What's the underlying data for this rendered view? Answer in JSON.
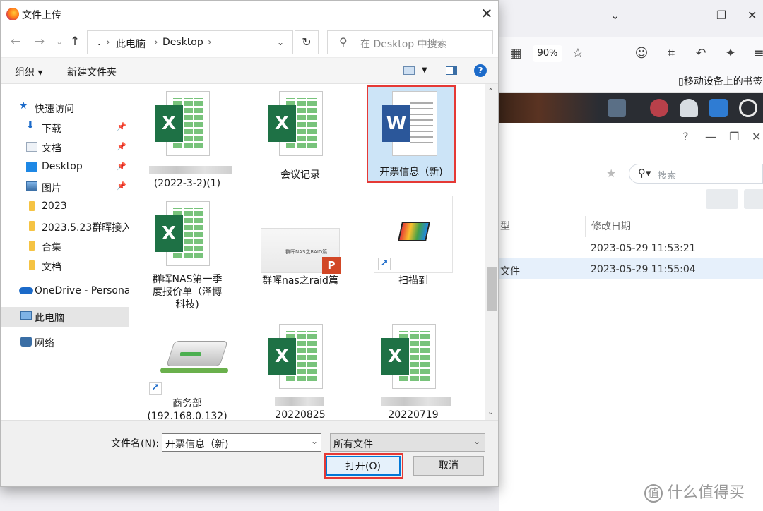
{
  "dialog": {
    "title": "文件上传",
    "address": {
      "root": ".",
      "sep": "›",
      "path": [
        "此电脑",
        "Desktop"
      ]
    },
    "search_placeholder": "在 Desktop 中搜索",
    "toolbar": {
      "organize": "组织 ▾",
      "new_folder": "新建文件夹"
    },
    "nav": [
      {
        "label": "快速访问",
        "icon": "star-icon"
      },
      {
        "label": "下载",
        "icon": "download-icon",
        "pinned": true
      },
      {
        "label": "文档",
        "icon": "document-icon",
        "pinned": true
      },
      {
        "label": "Desktop",
        "icon": "desktop-icon",
        "pinned": true
      },
      {
        "label": "图片",
        "icon": "picture-icon",
        "pinned": true
      },
      {
        "label": "2023",
        "icon": "folder-icon"
      },
      {
        "label": "2023.5.23群晖接入",
        "icon": "folder-icon"
      },
      {
        "label": "合集",
        "icon": "folder-icon"
      },
      {
        "label": "文档",
        "icon": "folder-icon"
      },
      {
        "label": "OneDrive - Personal",
        "icon": "onedrive-icon"
      },
      {
        "label": "此电脑",
        "icon": "pc-icon",
        "selected": true
      },
      {
        "label": "网络",
        "icon": "network-icon"
      }
    ],
    "files": [
      {
        "label": "(2022-3-2)(1)",
        "type": "xlsx"
      },
      {
        "label": "会议记录",
        "type": "xlsx"
      },
      {
        "label": "开票信息（新)",
        "type": "docx",
        "selected": true
      },
      {
        "label_lines": [
          "群晖NAS第一季",
          "度报价单（泽博",
          "科技)"
        ],
        "type": "xlsx"
      },
      {
        "label": "群晖nas之raid篇",
        "type": "pptx",
        "thumb_text": "群晖NAS之RAID篇"
      },
      {
        "label": "扫描到",
        "type": "shortcut-scanner"
      },
      {
        "label": "商务部",
        "label2": "(192.168.0.132)",
        "type": "network-drive"
      },
      {
        "label": "20220825",
        "type": "xlsx"
      },
      {
        "label": "20220719",
        "type": "xlsx"
      }
    ],
    "filename_label": "文件名(N):",
    "filename_value": "开票信息（新)",
    "filetype_value": "所有文件",
    "open_button": "打开(O)",
    "cancel_button": "取消",
    "highlight_color": "#e53935"
  },
  "browser": {
    "zoom": "90%",
    "bookmark": "移动设备上的书签",
    "app": {
      "search_placeholder": "搜索",
      "col_type": "型",
      "col_modified": "修改日期",
      "rows": [
        {
          "type": "",
          "modified": "2023-05-29 11:53:21"
        },
        {
          "type": "文件",
          "modified": "2023-05-29 11:55:04"
        }
      ]
    }
  },
  "watermark": "什么值得买"
}
